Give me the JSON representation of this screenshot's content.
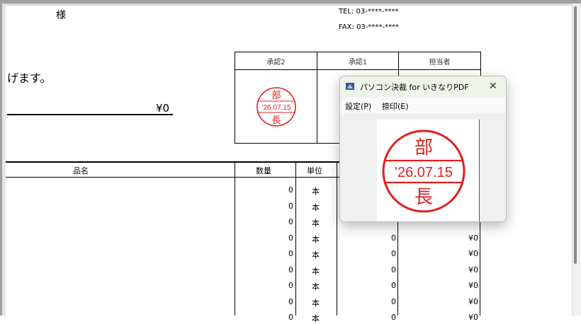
{
  "header": {
    "sama": "様",
    "tel": "TEL:  03-****-****",
    "fax": "FAX:  03-****-****",
    "greeting": "げます。",
    "total": "¥0"
  },
  "approval": {
    "headers": [
      "承認2",
      "承認1",
      "担当者"
    ]
  },
  "stamp": {
    "top": "部",
    "date": "'26.07.15",
    "bottom": "長",
    "color": "#e02020"
  },
  "items_table": {
    "headers": [
      "品名",
      "数量",
      "単位"
    ],
    "rows": [
      {
        "qty": "0",
        "unit": "本",
        "amt": "",
        "price": ""
      },
      {
        "qty": "0",
        "unit": "本",
        "amt": "",
        "price": ""
      },
      {
        "qty": "0",
        "unit": "本",
        "amt": "",
        "price": ""
      },
      {
        "qty": "0",
        "unit": "本",
        "amt": "0",
        "price": "¥0"
      },
      {
        "qty": "0",
        "unit": "本",
        "amt": "0",
        "price": "¥0"
      },
      {
        "qty": "0",
        "unit": "本",
        "amt": "0",
        "price": "¥0"
      },
      {
        "qty": "0",
        "unit": "本",
        "amt": "0",
        "price": "¥0"
      },
      {
        "qty": "0",
        "unit": "本",
        "amt": "0",
        "price": "¥0"
      },
      {
        "qty": "0",
        "unit": "本",
        "amt": "0",
        "price": "¥0"
      }
    ]
  },
  "dialog": {
    "title": "パソコン決裁 for いきなりPDF",
    "icon": "app-icon",
    "close": "✕",
    "menu": [
      "設定(P)",
      "捺印(E)"
    ]
  }
}
